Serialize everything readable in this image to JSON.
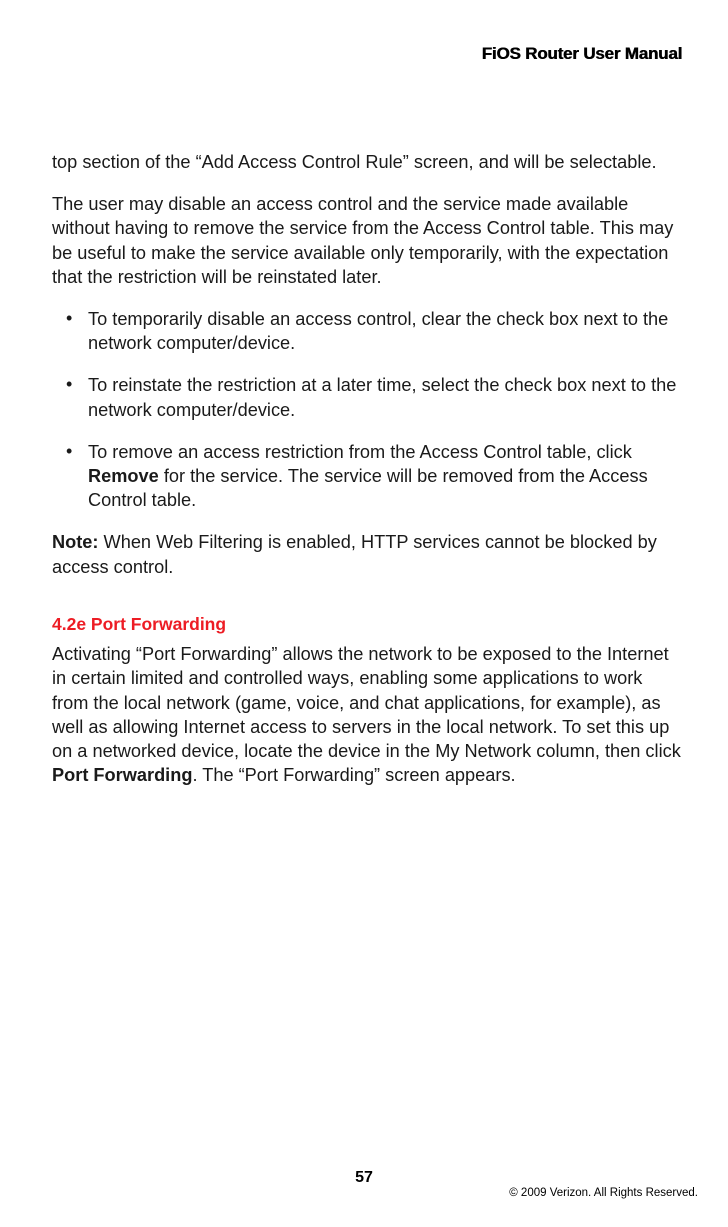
{
  "header": {
    "title": "FiOS Router User Manual"
  },
  "body": {
    "continuation": "top section of the “Add Access Control Rule” screen, and will be selectable.",
    "para1": "The user may disable an access control and the service made available without having to remove the service from the Access Control table. This may be useful to make the service available only temporarily, with the expectation that the restriction will be reinstated later.",
    "bullets": {
      "b1": "To temporarily disable an access control, clear the check box next to the network computer/device.",
      "b2": "To reinstate the restriction at a later time, select the check box next to the network computer/device.",
      "b3_pre": "To remove an access restriction from the Access Control table, click ",
      "b3_bold": "Remove",
      "b3_post": " for the service. The service will be removed from the Access Control table."
    },
    "note_label": "Note:",
    "note_text": " When Web Filtering is enabled, HTTP services cannot be blocked by access control.",
    "section_heading": "4.2e  Port Forwarding",
    "section_para_pre": "Activating “Port Forwarding” allows the network to be exposed to the Internet in certain limited and controlled ways, enabling some applications to work from the local network (game, voice, and chat applications, for example), as well as allowing Internet access to servers in the local network. To set this up on a networked device, locate the device in the My Network column, then click ",
    "section_para_bold": "Port Forwarding",
    "section_para_post": ". The “Port Forwarding” screen appears."
  },
  "footer": {
    "page_number": "57",
    "copyright": "© 2009 Verizon. All Rights Reserved."
  }
}
